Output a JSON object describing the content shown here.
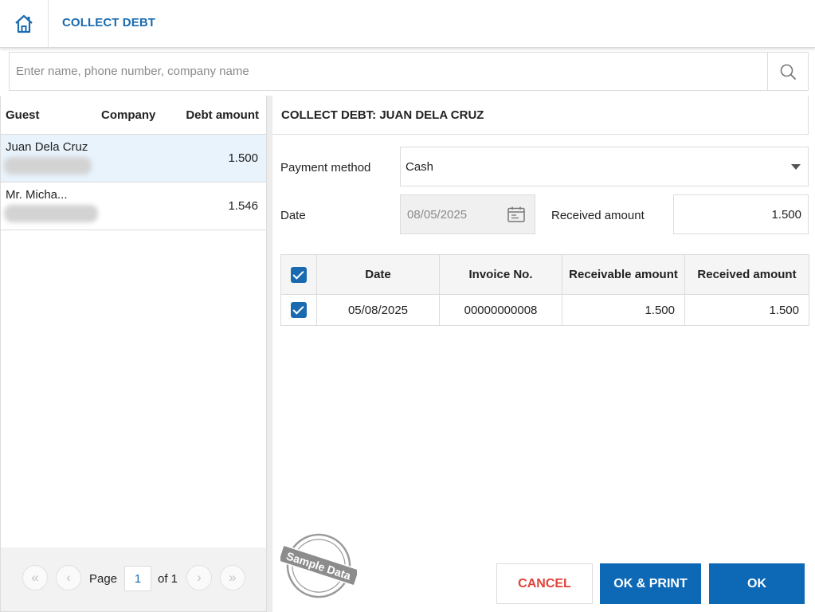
{
  "header": {
    "title": "COLLECT DEBT",
    "home_icon": "home-icon"
  },
  "search": {
    "placeholder": "Enter name, phone number, company name",
    "value": "",
    "icon": "search-icon"
  },
  "guest_list": {
    "columns": [
      "Guest",
      "Company",
      "Debt amount"
    ],
    "rows": [
      {
        "name": "Juan Dela Cruz",
        "company": "",
        "debt": "1.500",
        "selected": true
      },
      {
        "name": "Mr. Micha...",
        "company": "",
        "debt": "1.546",
        "selected": false
      }
    ]
  },
  "pagination": {
    "page_label": "Page",
    "page": "1",
    "of_label": "of 1"
  },
  "collect": {
    "title": "COLLECT DEBT: JUAN DELA CRUZ",
    "payment_method_label": "Payment method",
    "payment_method": "Cash",
    "date_label": "Date",
    "date": "08/05/2025",
    "received_amount_label": "Received amount",
    "received_amount": "1.500"
  },
  "invoice_table": {
    "columns": [
      "Date",
      "Invoice No.",
      "Receivable amount",
      "Received amount"
    ],
    "rows": [
      {
        "date": "05/08/2025",
        "invoice_no": "00000000008",
        "receivable": "1.500",
        "received": "1.500",
        "checked": true
      }
    ]
  },
  "stamp": {
    "text": "Sample Data"
  },
  "buttons": {
    "cancel": "CANCEL",
    "ok_print": "OK & PRINT",
    "ok": "OK"
  },
  "colors": {
    "accent": "#0d68b6",
    "title_blue": "#1a6ab0",
    "cancel_red": "#e0443b",
    "selected_row": "#e8f3fc"
  }
}
